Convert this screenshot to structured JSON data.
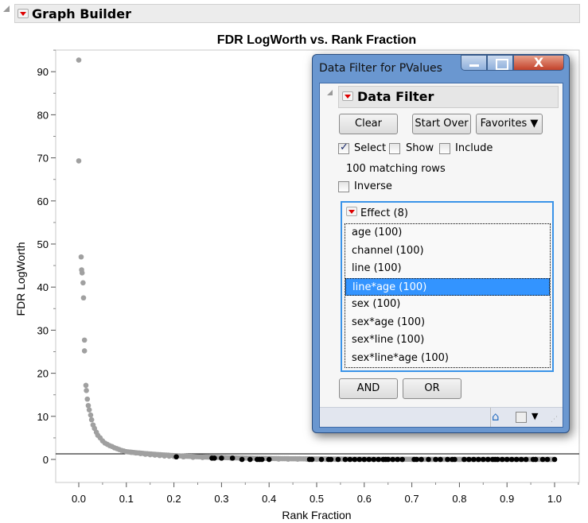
{
  "header": {
    "title": "Graph Builder"
  },
  "chart_data": {
    "type": "scatter",
    "title": "FDR LogWorth vs. Rank Fraction",
    "xlabel": "Rank Fraction",
    "ylabel": "FDR LogWorth",
    "xlim": [
      -0.045,
      1.05
    ],
    "ylim": [
      -5,
      96
    ],
    "xticks": [
      "0.0",
      "0.1",
      "0.2",
      "0.3",
      "0.4",
      "0.5",
      "0.6",
      "0.7",
      "0.8",
      "0.9",
      "1.0"
    ],
    "yticks": [
      "0",
      "10",
      "20",
      "30",
      "40",
      "50",
      "60",
      "70",
      "80",
      "90"
    ],
    "reference_line": 1.3,
    "unselected": [
      [
        0,
        92.7
      ],
      [
        0,
        69.3
      ],
      [
        0.005,
        47
      ],
      [
        0.006,
        44
      ],
      [
        0.007,
        43.3
      ],
      [
        0.009,
        41
      ],
      [
        0.01,
        37.5
      ],
      [
        0.012,
        27.7
      ],
      [
        0.012,
        25.2
      ],
      [
        0.015,
        17.2
      ],
      [
        0.016,
        16
      ],
      [
        0.018,
        14
      ],
      [
        0.02,
        12.5
      ],
      [
        0.022,
        11.5
      ],
      [
        0.025,
        10.3
      ],
      [
        0.027,
        9.2
      ],
      [
        0.03,
        8
      ],
      [
        0.033,
        7.2
      ],
      [
        0.037,
        6.3
      ],
      [
        0.04,
        5.6
      ],
      [
        0.045,
        5
      ],
      [
        0.05,
        4.3
      ],
      [
        0.055,
        3.8
      ],
      [
        0.06,
        3.5
      ],
      [
        0.065,
        3.2
      ],
      [
        0.07,
        3
      ],
      [
        0.075,
        2.7
      ],
      [
        0.08,
        2.5
      ],
      [
        0.085,
        2.3
      ],
      [
        0.09,
        2.1
      ],
      [
        0.095,
        1.95
      ],
      [
        0.1,
        1.8
      ],
      [
        0.11,
        1.65
      ],
      [
        0.12,
        1.5
      ],
      [
        0.13,
        1.35
      ],
      [
        0.14,
        1.2
      ],
      [
        0.15,
        1.1
      ],
      [
        0.16,
        1
      ],
      [
        0.17,
        0.9
      ],
      [
        0.18,
        0.8
      ],
      [
        0.19,
        0.75
      ],
      [
        0.2,
        0.7
      ],
      [
        0.22,
        0.6
      ],
      [
        0.24,
        0.5
      ],
      [
        0.26,
        0.45
      ],
      [
        0.28,
        0.4
      ],
      [
        0.3,
        0.35
      ],
      [
        0.32,
        0.3
      ],
      [
        0.34,
        0.2
      ],
      [
        0.36,
        0.15
      ],
      [
        0.38,
        0.12
      ],
      [
        0.4,
        0.1
      ],
      [
        0.42,
        0.08
      ],
      [
        0.44,
        0.06
      ],
      [
        0.46,
        0.05
      ],
      [
        0.48,
        0.04
      ],
      [
        0.5,
        0.03
      ],
      [
        0.52,
        0.02
      ],
      [
        0.54,
        0.02
      ],
      [
        0.56,
        0.01
      ],
      [
        0.58,
        0.01
      ],
      [
        0.6,
        0
      ],
      [
        0.62,
        0
      ],
      [
        0.64,
        0
      ],
      [
        0.66,
        0
      ],
      [
        0.68,
        0
      ],
      [
        0.7,
        0
      ],
      [
        0.72,
        0
      ],
      [
        0.74,
        0
      ],
      [
        0.76,
        0
      ],
      [
        0.78,
        0
      ],
      [
        0.8,
        0
      ],
      [
        0.82,
        0
      ],
      [
        0.84,
        0
      ],
      [
        0.86,
        0
      ],
      [
        0.88,
        0
      ],
      [
        0.9,
        0
      ],
      [
        0.92,
        0
      ],
      [
        0.94,
        0
      ],
      [
        0.96,
        0
      ],
      [
        0.98,
        0
      ],
      [
        0.99,
        0
      ]
    ],
    "selected": [
      [
        0.205,
        0.6
      ],
      [
        0.28,
        0.3
      ],
      [
        0.285,
        0.3
      ],
      [
        0.3,
        0.3
      ],
      [
        0.323,
        0.3
      ],
      [
        0.343,
        0
      ],
      [
        0.36,
        0
      ],
      [
        0.375,
        0
      ],
      [
        0.38,
        0
      ],
      [
        0.385,
        0
      ],
      [
        0.4,
        0
      ],
      [
        0.485,
        0
      ],
      [
        0.49,
        0
      ],
      [
        0.51,
        0
      ],
      [
        0.525,
        0
      ],
      [
        0.53,
        0
      ],
      [
        0.545,
        0
      ],
      [
        0.56,
        0
      ],
      [
        0.57,
        0
      ],
      [
        0.58,
        0
      ],
      [
        0.59,
        0
      ],
      [
        0.6,
        0
      ],
      [
        0.61,
        0
      ],
      [
        0.62,
        0
      ],
      [
        0.63,
        0
      ],
      [
        0.64,
        0
      ],
      [
        0.645,
        0
      ],
      [
        0.65,
        0
      ],
      [
        0.66,
        0
      ],
      [
        0.67,
        0
      ],
      [
        0.68,
        0
      ],
      [
        0.705,
        0
      ],
      [
        0.71,
        0
      ],
      [
        0.72,
        0
      ],
      [
        0.735,
        0
      ],
      [
        0.75,
        0
      ],
      [
        0.76,
        0
      ],
      [
        0.775,
        0
      ],
      [
        0.785,
        0
      ],
      [
        0.79,
        0
      ],
      [
        0.81,
        0
      ],
      [
        0.82,
        0
      ],
      [
        0.83,
        0
      ],
      [
        0.84,
        0
      ],
      [
        0.85,
        0
      ],
      [
        0.86,
        0
      ],
      [
        0.87,
        0
      ],
      [
        0.875,
        0
      ],
      [
        0.88,
        0
      ],
      [
        0.89,
        0
      ],
      [
        0.9,
        0
      ],
      [
        0.91,
        0
      ],
      [
        0.92,
        0
      ],
      [
        0.93,
        0
      ],
      [
        0.94,
        0
      ],
      [
        0.955,
        0
      ],
      [
        0.96,
        0
      ],
      [
        0.975,
        0
      ],
      [
        0.985,
        0
      ],
      [
        1.0,
        0
      ]
    ],
    "colors": {
      "unselected": "#a0a0a0",
      "selected": "#000000"
    }
  },
  "dialog": {
    "title": "Data Filter for PValues",
    "close_glyph": "X",
    "section": "Data Filter",
    "clear": "Clear",
    "start_over": "Start Over",
    "favorites": "Favorites ▼",
    "select": "Select",
    "show": "Show",
    "include": "Include",
    "select_checked": true,
    "show_checked": false,
    "include_checked": false,
    "matching": "100 matching rows",
    "inverse": "Inverse",
    "effect_header": "Effect (8)",
    "effects": [
      "age (100)",
      "channel (100)",
      "line (100)",
      "line*age (100)",
      "sex (100)",
      "sex*age (100)",
      "sex*line (100)",
      "sex*line*age (100)"
    ],
    "selected_effect": "line*age (100)",
    "and": "AND",
    "or": "OR"
  }
}
